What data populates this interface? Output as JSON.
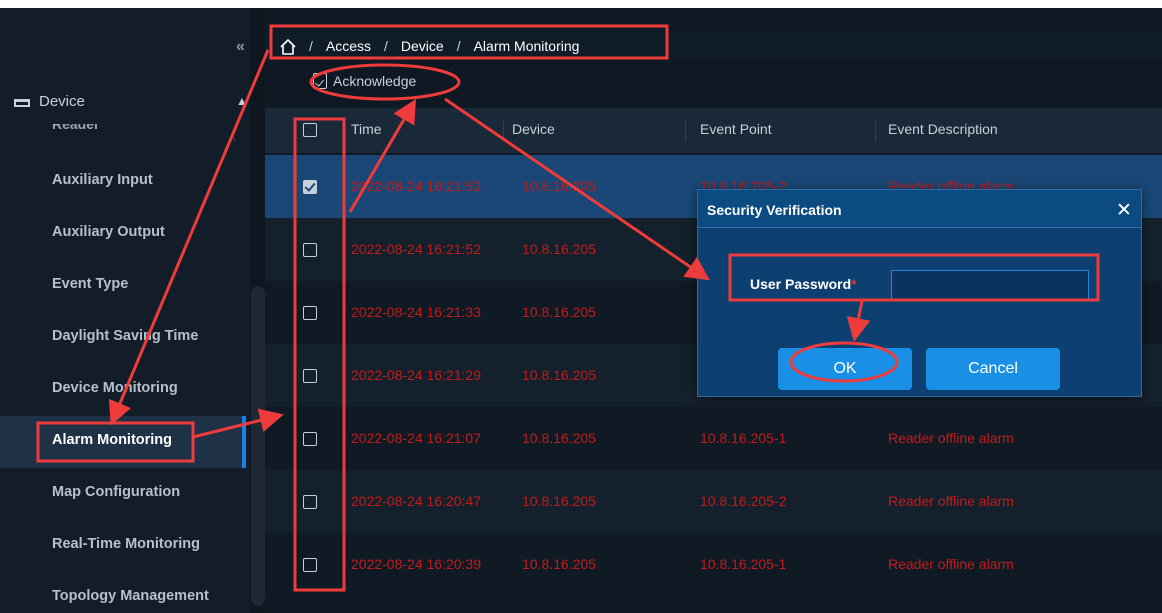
{
  "sidebar": {
    "collapse_icon": "double-chevron-left-icon",
    "group": {
      "label": "Device",
      "icon": "device-icon",
      "caret": "chevron-up-icon"
    },
    "cut_item": "Reader",
    "items": [
      {
        "label": "Auxiliary Input"
      },
      {
        "label": "Auxiliary Output"
      },
      {
        "label": "Event Type"
      },
      {
        "label": "Daylight Saving Time"
      },
      {
        "label": "Device Monitoring"
      },
      {
        "label": "Alarm Monitoring",
        "active": true
      },
      {
        "label": "Map Configuration"
      },
      {
        "label": "Real-Time Monitoring"
      },
      {
        "label": "Topology Management"
      }
    ]
  },
  "breadcrumb": {
    "home_icon": "home-icon",
    "items": [
      "Access",
      "Device",
      "Alarm Monitoring"
    ],
    "separator": "/"
  },
  "toolbar": {
    "acknowledge_label": "Acknowledge",
    "acknowledge_icon": "acknowledge-icon"
  },
  "table": {
    "columns": [
      "Time",
      "Device",
      "Event Point",
      "Event Description"
    ],
    "rows": [
      {
        "checked": true,
        "time": "2022-08-24 16:21:52",
        "device": "10.8.16.205",
        "point": "10.8.16.205-2",
        "desc": "Reader offline alarm"
      },
      {
        "checked": false,
        "time": "2022-08-24 16:21:52",
        "device": "10.8.16.205",
        "point": "",
        "desc": ""
      },
      {
        "checked": false,
        "time": "2022-08-24 16:21:33",
        "device": "10.8.16.205",
        "point": "",
        "desc": ""
      },
      {
        "checked": false,
        "time": "2022-08-24 16:21:29",
        "device": "10.8.16.205",
        "point": "",
        "desc": ""
      },
      {
        "checked": false,
        "time": "2022-08-24 16:21:07",
        "device": "10.8.16.205",
        "point": "10.8.16.205-1",
        "desc": "Reader offline alarm"
      },
      {
        "checked": false,
        "time": "2022-08-24 16:20:47",
        "device": "10.8.16.205",
        "point": "10.8.16.205-2",
        "desc": "Reader offline alarm"
      },
      {
        "checked": false,
        "time": "2022-08-24 16:20:39",
        "device": "10.8.16.205",
        "point": "10.8.16.205-1",
        "desc": "Reader offline alarm"
      }
    ]
  },
  "dialog": {
    "title": "Security Verification",
    "close_icon": "close-icon",
    "password_label": "User Password",
    "required_mark": "*",
    "password_value": "",
    "ok_label": "OK",
    "cancel_label": "Cancel"
  },
  "colors": {
    "accent": "#1a8fe6",
    "alarm_text": "#c21b1b",
    "annotation": "#ee3b3b",
    "selected_row": "#1a4775"
  }
}
